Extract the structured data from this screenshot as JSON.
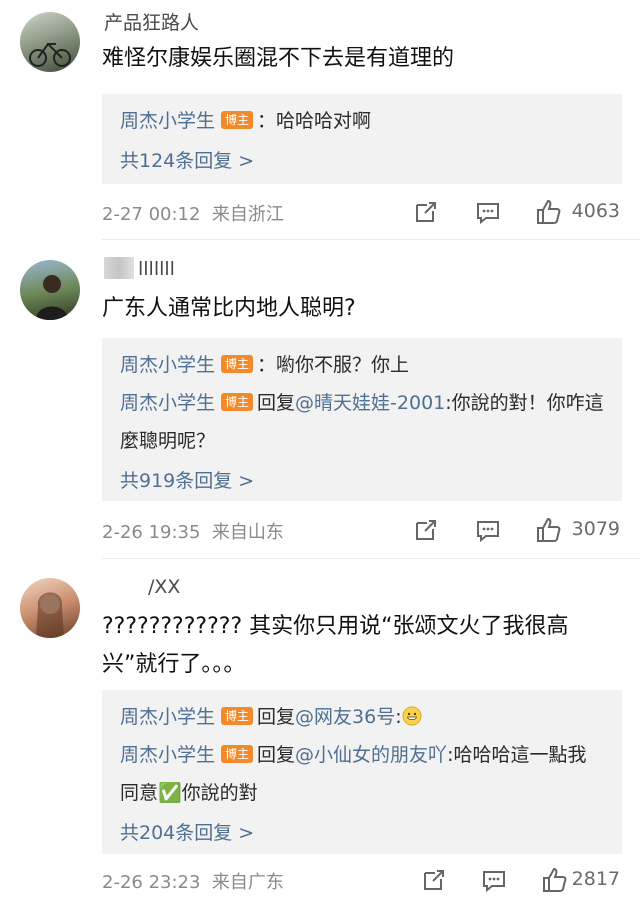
{
  "comments": [
    {
      "username": "产品狂路人",
      "text": "难怪尔康娱乐圈混不下去是有道理的",
      "replies": [
        {
          "author": "周杰小学生",
          "badge": "博主",
          "text": "：哈哈哈对啊"
        }
      ],
      "more_replies": "共124条回复 >",
      "time": "2-27 00:12",
      "location": "来自浙江",
      "likes": "4063"
    },
    {
      "username": "lllllll",
      "text": "广东人通常比内地人聪明?",
      "replies": [
        {
          "author": "周杰小学生",
          "badge": "博主",
          "text": "：喲你不服？你上"
        },
        {
          "author": "周杰小学生",
          "badge": "博主",
          "prefix": "回复",
          "mention": "@晴天娃娃-2001",
          "text": ":你說的對！你咋這麼聰明呢？"
        }
      ],
      "more_replies": "共919条回复 >",
      "time": "2-26 19:35",
      "location": "来自山东",
      "likes": "3079"
    },
    {
      "username": "/XX",
      "text": "???????????? 其实你只用说“张颂文火了我很高兴”就行了。。。",
      "replies": [
        {
          "author": "周杰小学生",
          "badge": "博主",
          "prefix": "回复",
          "mention": "@网友36号",
          "text": ":"
        },
        {
          "author": "周杰小学生",
          "badge": "博主",
          "prefix": "回复",
          "mention": "@小仙女的朋友吖",
          "text": ":哈哈哈這一點我同意✅你說的對"
        }
      ],
      "more_replies": "共204条回复 >",
      "time": "2-26 23:23",
      "location": "来自广东",
      "likes": "2817"
    }
  ],
  "icons": {
    "share": "share-icon",
    "comment": "comment-icon",
    "like": "thumbs-up-icon",
    "emoji": "grinning-emoji-icon"
  },
  "colors": {
    "link": "#4f6f93",
    "badge": "#f28a2a",
    "reply_bg": "#f2f2f2",
    "meta": "#8a8a8a"
  }
}
